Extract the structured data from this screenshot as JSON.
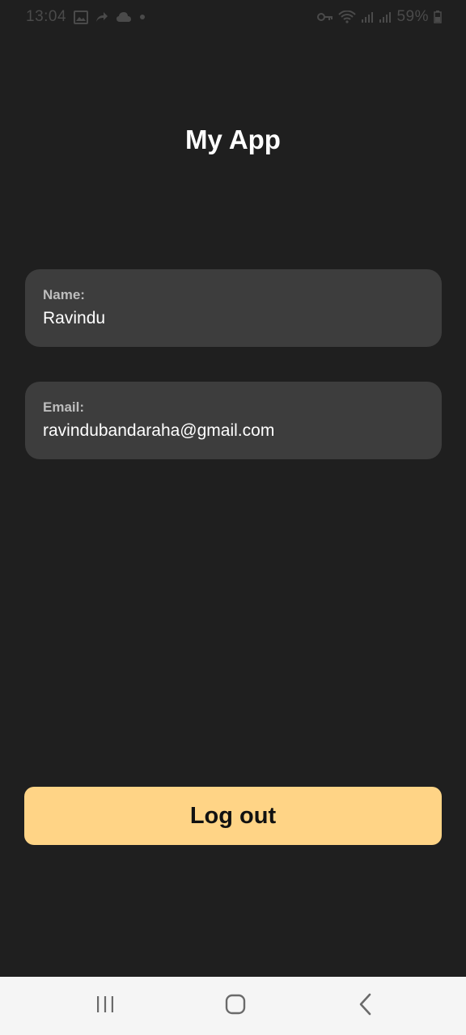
{
  "status_bar": {
    "time": "13:04",
    "battery": "59%",
    "left_icons": [
      "gallery-icon",
      "share-arrow-icon",
      "cloud-icon",
      "dot-icon"
    ],
    "right_icons": [
      "key-icon",
      "wifi-icon",
      "signal-icon",
      "signal-icon",
      "battery-icon"
    ]
  },
  "header": {
    "title": "My App"
  },
  "profile": {
    "name_label": "Name:",
    "name_value": "Ravindu",
    "email_label": "Email:",
    "email_value": "ravindubandaraha@gmail.com"
  },
  "actions": {
    "logout_label": "Log out"
  },
  "nav_bar": {
    "icons": [
      "recents-icon",
      "home-icon",
      "back-icon"
    ]
  },
  "colors": {
    "background": "#1f1f1f",
    "card": "#3d3d3d",
    "accent": "#ffd486",
    "nav_background": "#f5f5f5"
  }
}
